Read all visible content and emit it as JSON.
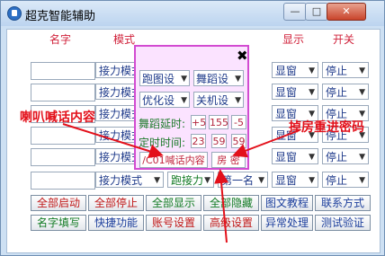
{
  "window": {
    "title": "超克智能辅助"
  },
  "columns": {
    "name": "名字",
    "mode": "模式",
    "display": "显示",
    "toggle": "开关"
  },
  "rows": [
    {
      "mode": "接力模式",
      "display": "显窗",
      "toggle": "停止"
    },
    {
      "mode": "接力模式",
      "display": "显窗",
      "toggle": "停止"
    },
    {
      "mode": "接力模式",
      "display": "显窗",
      "toggle": "停止"
    },
    {
      "mode": "接力模式",
      "display": "显窗",
      "toggle": "停止"
    },
    {
      "mode": "接力模式",
      "display": "显窗",
      "toggle": "停止"
    },
    {
      "mode": "接力模式",
      "display": "显窗",
      "toggle": "停止"
    }
  ],
  "row6_extra": {
    "relay": "跑接力",
    "first": "第一名"
  },
  "popup": {
    "sel1": "跑图设",
    "sel2": "舞蹈设",
    "sel3": "优化设",
    "sel4": "关机设",
    "dance_delay_label": "舞蹈延时:",
    "dance_delay": [
      "+5",
      "155",
      "-5"
    ],
    "timer_label": "定时时间:",
    "timer": [
      "23",
      "59",
      "59"
    ],
    "shout_field": "/C01喊话内容",
    "room_field": "房 密"
  },
  "bottom": {
    "row1": [
      "全部启动",
      "全部停止",
      "全部显示",
      "全部隐藏",
      "图文教程",
      "联系方式"
    ],
    "row2": [
      "名字填写",
      "快捷功能",
      "账号设置",
      "高级设置",
      "异常处理",
      "测试验证"
    ]
  },
  "annotations": {
    "left": "喇叭喊话内容",
    "right": "掉房重进密码"
  }
}
